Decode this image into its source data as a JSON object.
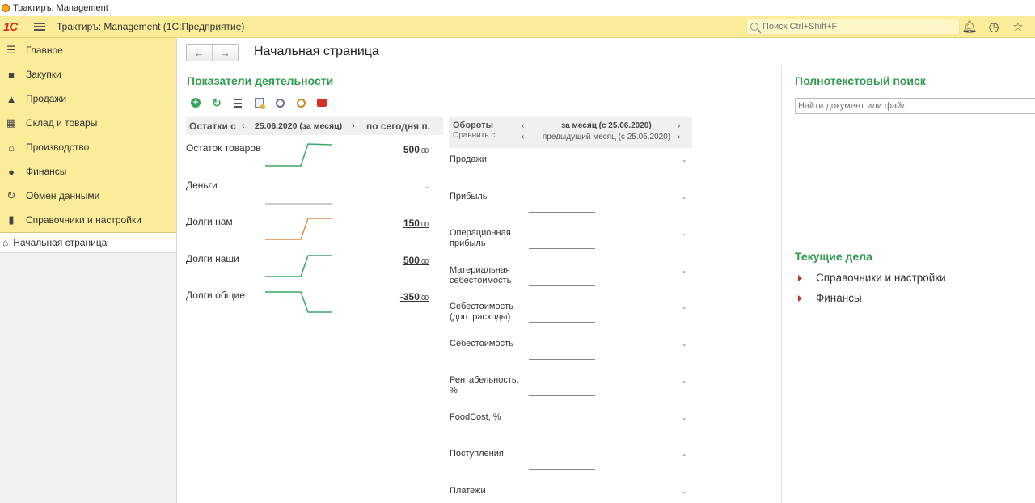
{
  "window": {
    "title": "Трактиръ: Management"
  },
  "header": {
    "app_title": "Трактиръ: Management  (1С:Предприятие)",
    "search_placeholder": "Поиск Ctrl+Shift+F"
  },
  "sidebar": {
    "items": [
      {
        "label": "Главное",
        "icon": "menu-icon"
      },
      {
        "label": "Закупки",
        "icon": "truck-icon"
      },
      {
        "label": "Продажи",
        "icon": "sales-icon"
      },
      {
        "label": "Склад и товары",
        "icon": "warehouse-icon"
      },
      {
        "label": "Производство",
        "icon": "factory-icon"
      },
      {
        "label": "Финансы",
        "icon": "coin-icon"
      },
      {
        "label": "Обмен данными",
        "icon": "sync-icon"
      },
      {
        "label": "Справочники и настройки",
        "icon": "books-icon"
      }
    ],
    "home": {
      "label": "Начальная страница",
      "icon": "home-icon"
    }
  },
  "main": {
    "page_title": "Начальная страница",
    "kpi_title": "Показатели деятельности",
    "remains": {
      "label": "Остатки с",
      "period": "25.06.2020 (за месяц)",
      "today": "по сегодня п.",
      "rows": [
        {
          "name": "Остаток товаров",
          "value_int": "500",
          "value_dec": ".00",
          "trend": "up",
          "color": "#3aaa6a"
        },
        {
          "name": "Деньги",
          "value_int": "",
          "value_dec": "",
          "dash": "-",
          "trend": "flat",
          "color": "#999999"
        },
        {
          "name": "Долги нам",
          "value_int": "150",
          "value_dec": ".00",
          "trend": "up",
          "color": "#e08a4a"
        },
        {
          "name": "Долги наши",
          "value_int": "500",
          "value_dec": ".00",
          "trend": "up",
          "color": "#3aaa6a"
        },
        {
          "name": "Долги общие",
          "value_int": "-350",
          "value_dec": ".00",
          "trend": "down",
          "color": "#3aaa6a"
        }
      ]
    },
    "turnover": {
      "label": "Обороты",
      "compare_label": "Сравнить с",
      "period": "за месяц (с 25.06.2020)",
      "compare_period": "предыдущий месяц (с 25.05.2020)",
      "rows": [
        {
          "name": "Продажи",
          "value": "-"
        },
        {
          "name": "Прибыль",
          "value": "-"
        },
        {
          "name": "Операционная прибыль",
          "value": "-"
        },
        {
          "name": "Материальная себестоимость",
          "value": "-"
        },
        {
          "name": "Себестоимость (доп. расходы)",
          "value": "-"
        },
        {
          "name": "Себестоимость",
          "value": "-"
        },
        {
          "name": "Рентабельность, %",
          "value": "-"
        },
        {
          "name": "FoodCost, %",
          "value": "-"
        },
        {
          "name": "Поступления",
          "value": "-"
        },
        {
          "name": "Платежи",
          "value": "-"
        }
      ]
    }
  },
  "right": {
    "fts_title": "Полнотекстовый поиск",
    "fts_placeholder": "Найти документ или файл",
    "tasks_title": "Текущие дела",
    "tasks": [
      "Справочники и настройки",
      "Финансы"
    ]
  },
  "colors": {
    "accent_green": "#2e9b4c",
    "header_yellow": "#fbec9a",
    "logo_red": "#d52b1e"
  }
}
